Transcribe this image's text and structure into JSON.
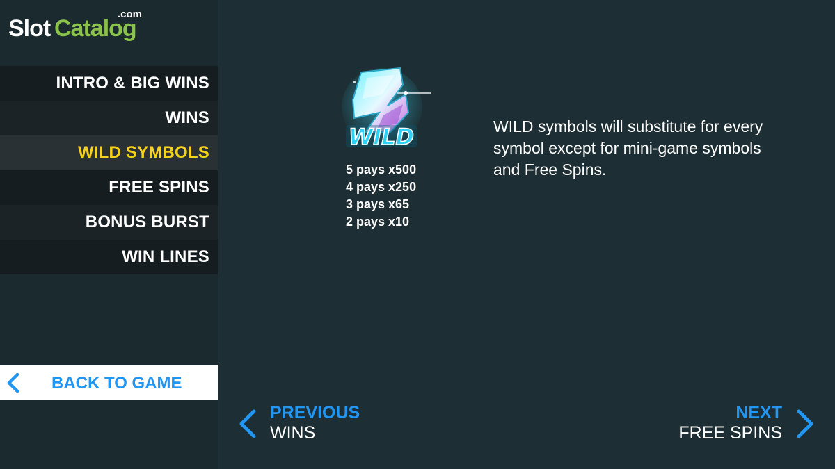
{
  "logo": {
    "part1": "Slot",
    "part2": "Catalog",
    "suffix": ".com"
  },
  "menu": {
    "items": [
      {
        "label": "INTRO & BIG WINS"
      },
      {
        "label": "WINS"
      },
      {
        "label": "WILD SYMBOLS",
        "active": true
      },
      {
        "label": "FREE SPINS"
      },
      {
        "label": "BONUS BURST"
      },
      {
        "label": "WIN LINES"
      }
    ]
  },
  "back_button": {
    "label": "BACK TO GAME",
    "icon": "chevron-left-icon"
  },
  "symbol": {
    "name": "WILD",
    "pays": [
      "5 pays x500",
      "4 pays x250",
      "3 pays x65",
      "2 pays x10"
    ]
  },
  "description": "WILD symbols will substitute for every symbol except for mini-game symbols and Free Spins.",
  "nav": {
    "previous_title": "PREVIOUS",
    "previous_sub": "WINS",
    "next_title": "NEXT",
    "next_sub": "FREE SPINS"
  },
  "colors": {
    "background": "#1d2f34",
    "sidebar": "#1a2a2e",
    "accent_blue": "#2196f3",
    "active_yellow": "#f6d21a",
    "logo_green": "#8bc34a"
  }
}
